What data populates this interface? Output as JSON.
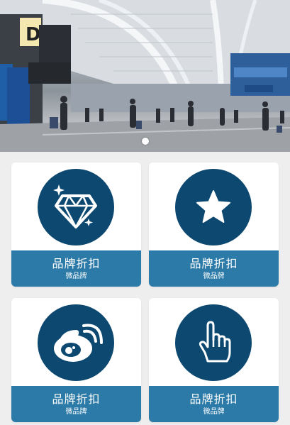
{
  "banner": {
    "gate_letter": "D",
    "slide_count": 1,
    "active_slide": 1
  },
  "cards": [
    {
      "icon": "diamond-icon",
      "title": "品牌折扣",
      "subtitle": "微品牌"
    },
    {
      "icon": "star-icon",
      "title": "品牌折扣",
      "subtitle": "微品牌"
    },
    {
      "icon": "weibo-icon",
      "title": "品牌折扣",
      "subtitle": "微品牌"
    },
    {
      "icon": "pointer-hand-icon",
      "title": "品牌折扣",
      "subtitle": "微品牌"
    }
  ],
  "colors": {
    "icon_circle": "#0c4870",
    "label_bar": "#2c7aa7",
    "background": "#eeeeee"
  }
}
